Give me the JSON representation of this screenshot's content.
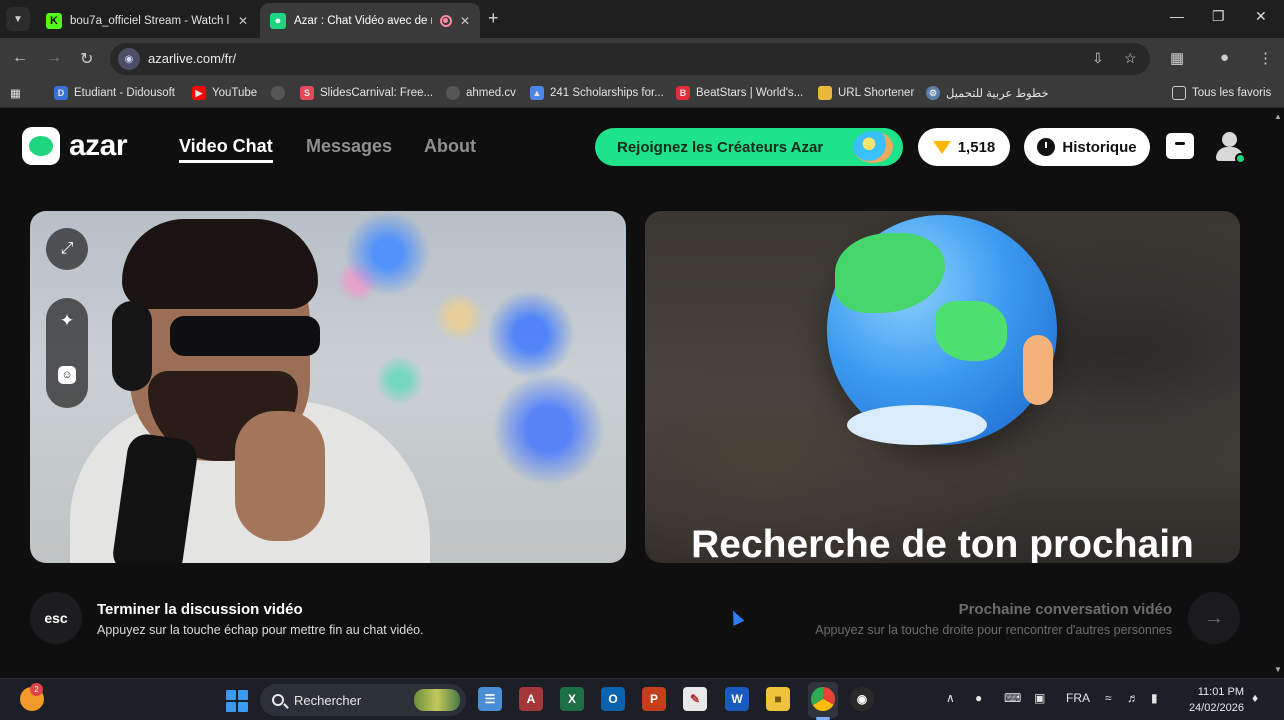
{
  "browser": {
    "tabs": [
      {
        "title": "bou7a_officiel Stream - Watch l",
        "favicon": "kick-icon",
        "color": "#53fc18"
      },
      {
        "title": "Azar : Chat Vidéo avec de n",
        "favicon": "azar-icon",
        "color": "#1fd67e",
        "active": true
      }
    ],
    "url": "azarlive.com/fr/",
    "bookmarks": [
      {
        "label": "Etudiant - Didousoft",
        "icon": "didousoft-icon"
      },
      {
        "label": "YouTube",
        "icon": "youtube-icon"
      },
      {
        "label": "",
        "icon": "globe-icon"
      },
      {
        "label": "SlidesCarnival: Free...",
        "icon": "slidescarnival-icon"
      },
      {
        "label": "ahmed.cv",
        "icon": "globe-icon"
      },
      {
        "label": "241 Scholarships for...",
        "icon": "scholarship-icon"
      },
      {
        "label": "BeatStars | World's...",
        "icon": "beatstars-icon"
      },
      {
        "label": "URL Shortener",
        "icon": "folder-icon"
      },
      {
        "label": "خطوط عربية للتحميل",
        "icon": "gear-icon"
      }
    ],
    "all_bookmarks": "Tous les favoris"
  },
  "azar": {
    "logo_text": "azar",
    "nav": [
      {
        "label": "Video Chat",
        "active": true
      },
      {
        "label": "Messages"
      },
      {
        "label": "About"
      }
    ],
    "creators_button": "Rejoignez les Créateurs Azar",
    "gems_count": "1,518",
    "history_button": "Historique",
    "remote_text": "Recherche de ton prochain",
    "end_chat": {
      "key": "esc",
      "title": "Terminer la discussion vidéo",
      "subtitle": "Appuyez sur la touche échap pour mettre fin au chat vidéo."
    },
    "next_chat": {
      "title": "Prochaine conversation vidéo",
      "subtitle": "Appuyez sur la touche droite pour rencontrer d'autres personnes",
      "icon": "arrow-right-icon"
    },
    "accent_color": "#1fe38a"
  },
  "taskbar": {
    "weather_badge": "2",
    "search_placeholder": "Rechercher",
    "language": "FRA",
    "time": "11:01 PM",
    "date": "24/02/2026"
  }
}
